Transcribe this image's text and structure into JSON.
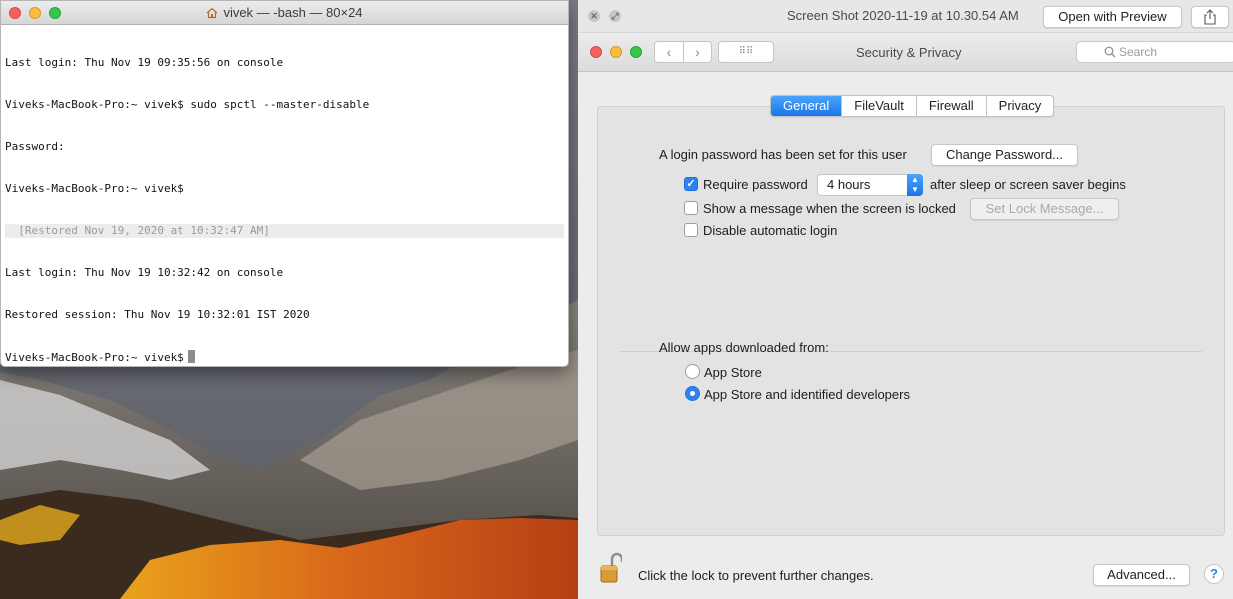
{
  "terminal": {
    "title": "vivek — -bash — 80×24",
    "home_icon": "house-icon",
    "lines": [
      "Last login: Thu Nov 19 09:35:56 on console",
      "Viveks-MacBook-Pro:~ vivek$ sudo spctl --master-disable",
      "Password:",
      "Viveks-MacBook-Pro:~ vivek$",
      "  [Restored Nov 19, 2020 at 10:32:47 AM]",
      "Last login: Thu Nov 19 10:32:42 on console",
      "Restored session: Thu Nov 19 10:32:01 IST 2020",
      "Viveks-MacBook-Pro:~ vivek$"
    ]
  },
  "preview": {
    "title": "Screen Shot 2020-11-19 at 10.30.54 AM",
    "open_button": "Open with Preview",
    "share_icon": "share-icon"
  },
  "prefs": {
    "window_title": "Security & Privacy",
    "search_placeholder": "Search",
    "tabs": [
      "General",
      "FileVault",
      "Firewall",
      "Privacy"
    ],
    "active_tab": "General",
    "login_password_text": "A login password has been set for this user",
    "change_password_button": "Change Password...",
    "require_password_label": "Require password",
    "require_password_checked": true,
    "require_password_value": "4 hours",
    "after_sleep_text": "after sleep or screen saver begins",
    "show_message_label": "Show a message when the screen is locked",
    "show_message_checked": false,
    "set_lock_message_button": "Set Lock Message...",
    "disable_auto_login_label": "Disable automatic login",
    "disable_auto_login_checked": false,
    "allow_apps_label": "Allow apps downloaded from:",
    "app_store_label": "App Store",
    "app_store_identified_label": "App Store and identified developers",
    "selected_source": "App Store and identified developers",
    "lock_text": "Click the lock to prevent further changes.",
    "advanced_button": "Advanced...",
    "help_label": "?"
  }
}
